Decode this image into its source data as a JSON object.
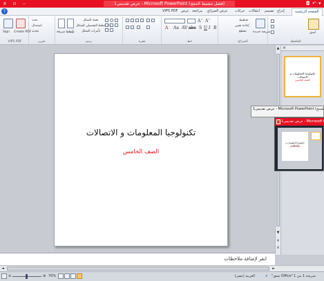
{
  "window": {
    "title": "عرض تقديمي1 - Microsoft PowerPoint (فشل تنشيط المنتج)",
    "minimize_glyph": "–",
    "restore_glyph": "▫",
    "close_glyph": "x"
  },
  "quick_access": {
    "save_glyph": "◘",
    "undo_glyph": "↶",
    "customize_glyph": "▾"
  },
  "tabs": [
    {
      "label": "الصفحة الرئيسية",
      "active": true
    },
    {
      "label": "إدراج"
    },
    {
      "label": "تصميم"
    },
    {
      "label": "انتقالات"
    },
    {
      "label": "حركات"
    },
    {
      "label": "عرض الشرائح"
    },
    {
      "label": "مراجعة"
    },
    {
      "label": "عرض"
    },
    {
      "label": "VIPS PDF"
    }
  ],
  "help_glyph": "?",
  "ribbon": {
    "groups": [
      {
        "label": "الحافظة"
      },
      {
        "label": "الشرائح"
      },
      {
        "label": "خط"
      },
      {
        "label": "فقرة"
      },
      {
        "label": "رسم"
      },
      {
        "label": "تحرير"
      },
      {
        "label": "VIPS PDF"
      }
    ],
    "paste_label": "لصق",
    "new_slide_label": "شريحة جديدة",
    "layout_label": "تخطيط",
    "reset_label": "إعادة تعيين",
    "section_label": "مقطع",
    "arrange_label": "ترتيب",
    "quick_styles_label": "أنماط سريعة",
    "shape_fill_label": "تعبئة الشكل",
    "shape_outline_label": "المخطط التفصيلي للشكل",
    "shape_effects_label": "تأثيرات الشكل",
    "find_label": "بحث",
    "replace_label": "استبدال",
    "select_label": "تحديد",
    "sign_label": "Sign",
    "create_pdf_label": "Create PDF",
    "font_buttons": [
      "B",
      "I",
      "U",
      "S",
      "abc",
      "AV",
      "Aa",
      "A"
    ],
    "font_size_up": "A˄",
    "font_size_down": "A˅"
  },
  "slide": {
    "title": "تكنولوجيا المعلومات و الاتصالات",
    "subtitle": "الصف الخامس",
    "title_color": "#111111",
    "subtitle_color": "#e0121c"
  },
  "thumbnail": {
    "number": "1",
    "title": "تكنولوجيا المعلومات و الاتصالات",
    "subtitle": "الصف الخامس"
  },
  "taskbar_preview": {
    "tooltip": "عرض تقديمي1 - Microsoft PowerPoint (فشل تنشيط المنتج)",
    "window_title": "عرض تقديمي1 - Microsoft PowerPoint"
  },
  "notes": {
    "placeholder": "انقر لإضافة ملاحظات"
  },
  "status": {
    "slide_counter": "شريحة 1 من 1",
    "theme": "\"نسق Office\"",
    "language": "العربية (مصر)",
    "zoom": "70%"
  },
  "colors": {
    "accent": "#e81123",
    "selection": "#f0b43b",
    "workspace": "#c8cbd1"
  }
}
